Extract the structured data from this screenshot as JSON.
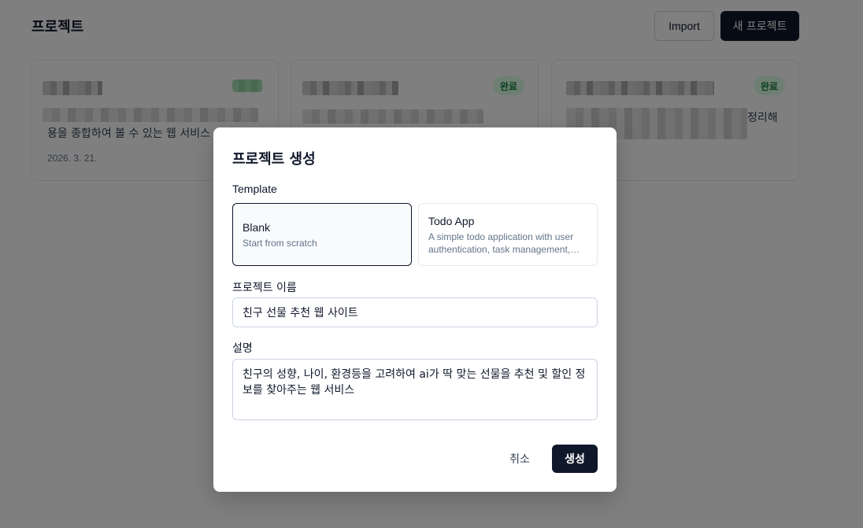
{
  "header": {
    "title": "프로젝트",
    "import_label": "Import",
    "new_project_label": "새 프로젝트"
  },
  "cards": [
    {
      "description": "용을 종합하여 볼 수 있는 웹 서비스",
      "date": "2026. 3. 21."
    },
    {
      "badge": "완료"
    },
    {
      "badge": "완료",
      "description": "정리해"
    }
  ],
  "modal": {
    "title": "프로젝트 생성",
    "template_label": "Template",
    "templates": [
      {
        "name": "Blank",
        "description": "Start from scratch"
      },
      {
        "name": "Todo App",
        "description": "A simple todo application with user authentication, task management, and more"
      }
    ],
    "name_label": "프로젝트 이름",
    "name_value": "친구 선물 추천 웹 사이트",
    "description_label": "설명",
    "description_value": "친구의 성향, 나이, 환경등을 고려하여 ai가 딱 맞는 선물을 추천 및 할인 정보를 찾아주는 웹 서비스",
    "cancel_label": "취소",
    "create_label": "생성"
  },
  "colors": {
    "primary": "#0f172a",
    "badge_bg": "#dcfce7",
    "badge_text": "#15803d",
    "overlay": "rgba(0,0,0,0.5)"
  }
}
